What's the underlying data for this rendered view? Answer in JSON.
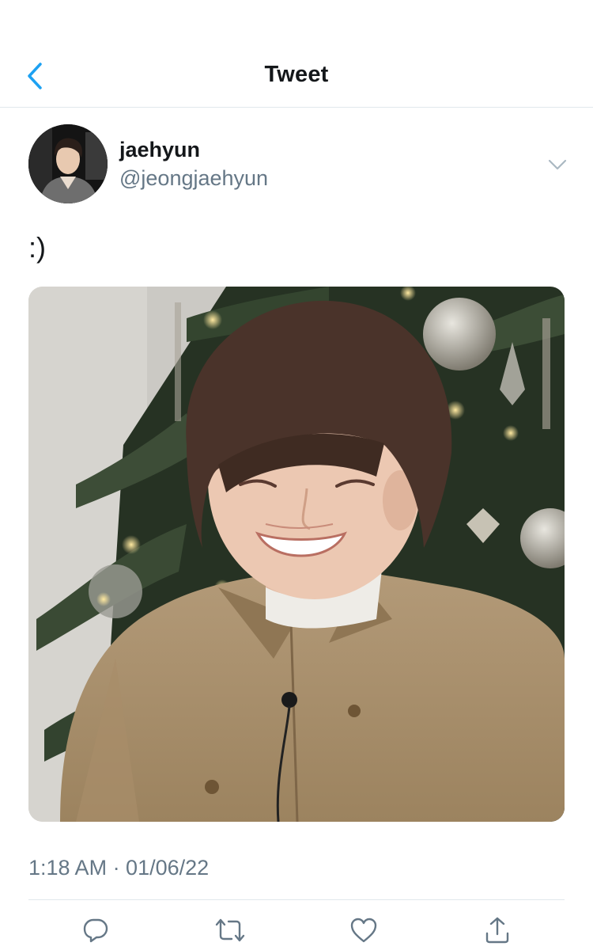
{
  "header": {
    "title": "Tweet",
    "back_icon": "chevron-left-icon",
    "accent_color": "#1da1f2"
  },
  "tweet": {
    "display_name": "jaehyun",
    "handle": "@jeongjaehyun",
    "text": ":)",
    "timestamp": "1:18 AM · 01/06/22",
    "menu_icon": "chevron-down-icon"
  },
  "actions": [
    {
      "icon": "reply-icon"
    },
    {
      "icon": "retweet-icon"
    },
    {
      "icon": "like-icon"
    },
    {
      "icon": "share-icon"
    }
  ],
  "colors": {
    "text": "#14171a",
    "secondary": "#657786",
    "border": "#e1e8ed"
  }
}
